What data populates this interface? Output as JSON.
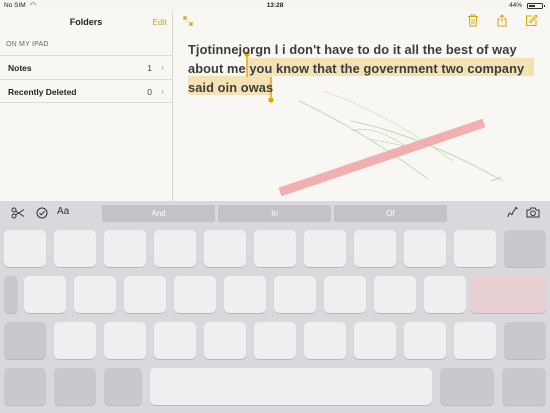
{
  "status_bar": {
    "carrier": "No SIM",
    "time": "13:28",
    "battery": "44%"
  },
  "sidebar": {
    "title": "Folders",
    "edit_label": "Edit",
    "section_header": "ON MY IPAD",
    "folders": [
      {
        "label": "Notes",
        "count": "1"
      },
      {
        "label": "Recently Deleted",
        "count": "0"
      }
    ]
  },
  "note": {
    "text_before_selection": "Tjotinnejorgn l i don't have to do it all the best of way about me ",
    "selected_text": "you know that the government two company said oin owas"
  },
  "keyboard": {
    "format_label": "Aa",
    "suggestions": [
      "And",
      "In",
      "Of"
    ]
  },
  "colors": {
    "accent": "#d9a300",
    "selection": "#f3e2b4",
    "sketch_red": "#f2a8a8",
    "sketch_green": "#b8e0b0"
  }
}
